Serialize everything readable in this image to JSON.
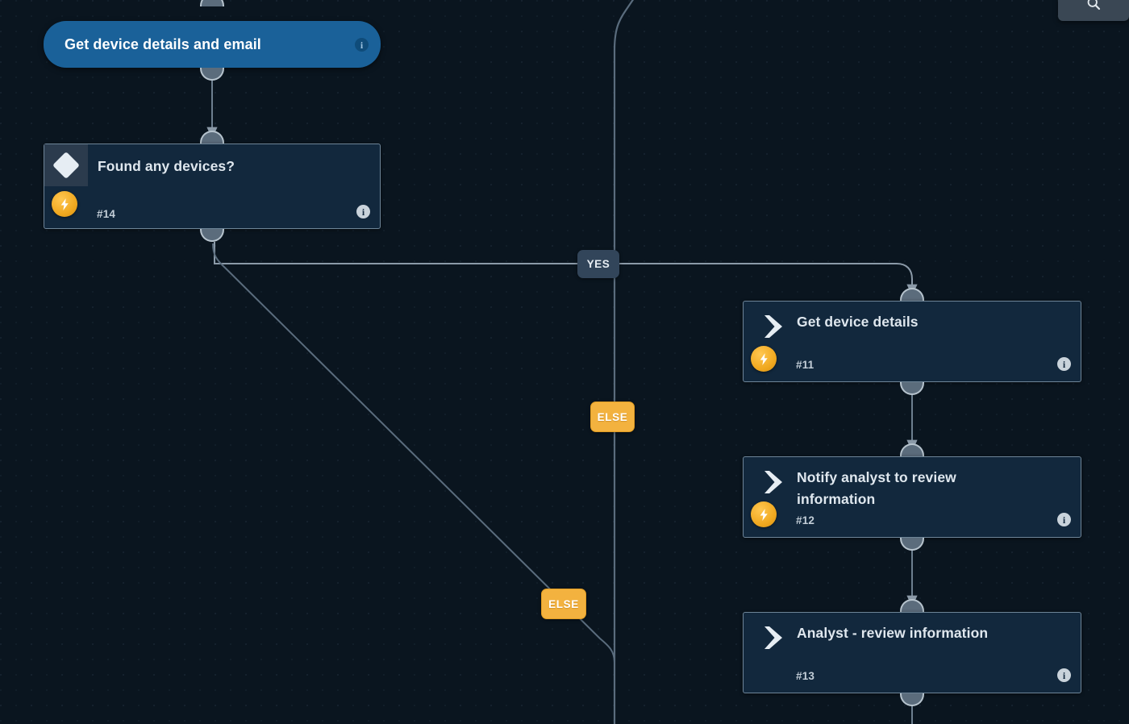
{
  "canvas": {
    "background_color": "#0a151f",
    "grid": "dotted"
  },
  "toolbar": {
    "search_button": {
      "icon": "search-icon",
      "label": ""
    }
  },
  "colors": {
    "start_node": "#1a6199",
    "card": "#12283d",
    "card_border": "#6e8598",
    "bolt_badge": "#f0a81f",
    "badge_else": "#f3b23f",
    "badge_yes": "#32455a",
    "wire": "#5a6c7d",
    "title_text": "#dfe7ee"
  },
  "nodes": [
    {
      "kind": "start",
      "name": "get-device-details-and-email",
      "title": "Get device details and email",
      "id_label": "",
      "icon": "",
      "has_bolt": false,
      "has_info": true
    },
    {
      "kind": "decision",
      "name": "found-any-devices",
      "title": "Found any devices?",
      "id_label": "#14",
      "icon": "diamond-icon",
      "has_bolt": true,
      "has_info": true
    },
    {
      "kind": "action",
      "name": "get-device-details",
      "title": "Get device details",
      "id_label": "#11",
      "icon": "chevron-right-icon",
      "has_bolt": true,
      "has_info": true
    },
    {
      "kind": "action",
      "name": "notify-analyst-to-review-information",
      "title": "Notify analyst to review information",
      "id_label": "#12",
      "icon": "chevron-right-icon",
      "has_bolt": true,
      "has_info": true
    },
    {
      "kind": "action",
      "name": "analyst-review-information",
      "title": "Analyst - review information",
      "id_label": "#13",
      "icon": "chevron-right-icon",
      "has_bolt": false,
      "has_info": true
    }
  ],
  "edge_labels": [
    {
      "name": "edge-label-yes",
      "text": "YES",
      "style": "yes"
    },
    {
      "name": "edge-label-else-main",
      "text": "ELSE",
      "style": "else"
    },
    {
      "name": "edge-label-else-branch",
      "text": "ELSE",
      "style": "else"
    }
  ]
}
